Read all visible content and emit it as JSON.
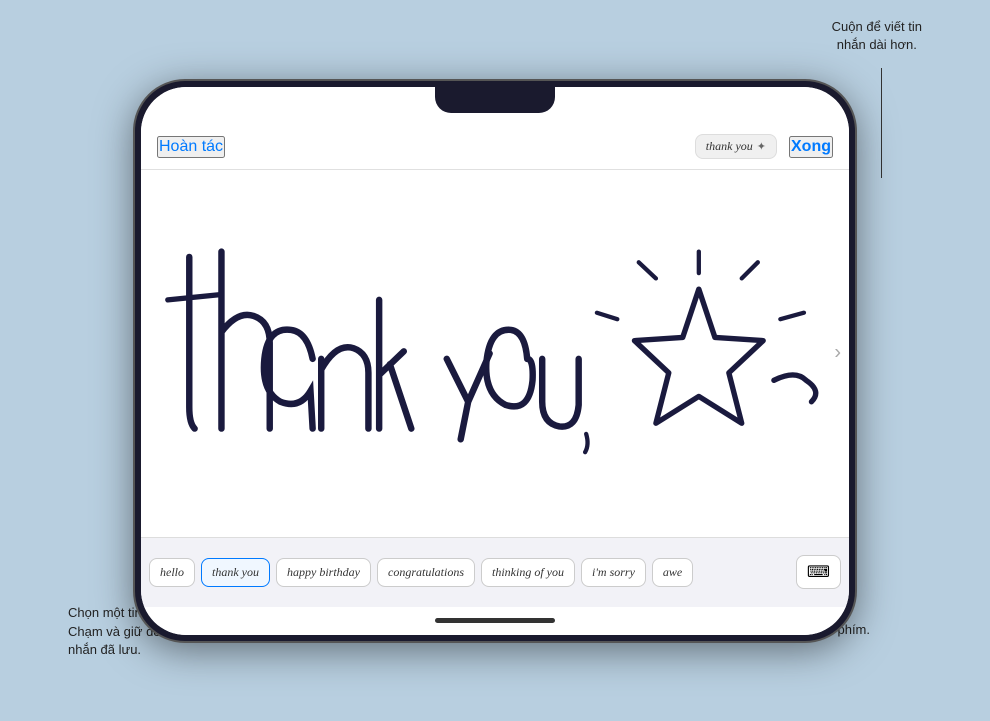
{
  "annotations": {
    "top_right": "Cuộn để viết tin\nnhắn dài hơn.",
    "bottom_left_line1": "Chọn một tin nhắn đã lưu.",
    "bottom_left_line2": "Chạm và giữ để xóa tin",
    "bottom_left_line3": "nhắn đã lưu.",
    "bottom_right": "Quay lại bàn phím."
  },
  "header": {
    "undo_label": "Hoàn tác",
    "preview_text": "thank you",
    "done_label": "Xong"
  },
  "presets": [
    {
      "label": "hello",
      "active": false
    },
    {
      "label": "thank you",
      "active": true
    },
    {
      "label": "happy birthday",
      "active": false
    },
    {
      "label": "congratulations",
      "active": false
    },
    {
      "label": "thinking of you",
      "active": false
    },
    {
      "label": "i'm sorry",
      "active": false
    },
    {
      "label": "awe",
      "active": false
    }
  ],
  "keyboard_icon": "⌨",
  "canvas": {
    "content": "thank you handwriting with star"
  }
}
